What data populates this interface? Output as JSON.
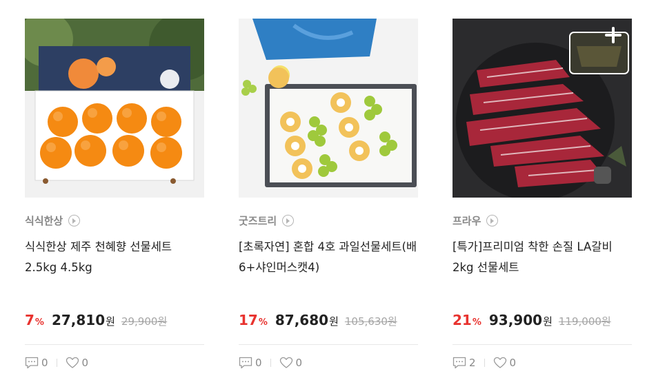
{
  "products": [
    {
      "image_icon": "tangerine-gift-box-photo",
      "seller": "식식한상",
      "title": "식식한상 제주 천혜향 선물세트 2.5kg 4.5kg",
      "discount": "7",
      "discount_unit": "%",
      "price": "27,810",
      "currency": "원",
      "original_price": "29,900원",
      "reviews": "0",
      "likes": "0"
    },
    {
      "image_icon": "fruit-gift-set-photo",
      "seller": "굿즈트리",
      "title": "[초록자연] 혼합 4호 과일선물세트(배6+샤인머스캣4)",
      "discount": "17",
      "discount_unit": "%",
      "price": "87,680",
      "currency": "원",
      "original_price": "105,630원",
      "reviews": "0",
      "likes": "0"
    },
    {
      "image_icon": "beef-ribs-gift-photo",
      "seller": "프라우",
      "title": "[특가]프리미엄 착한 손질 LA갈비 2kg 선물세트",
      "discount": "21",
      "discount_unit": "%",
      "price": "93,900",
      "currency": "원",
      "original_price": "119,000원",
      "reviews": "2",
      "likes": "0"
    }
  ],
  "colors": {
    "discount": "#e8332f",
    "muted": "#888888",
    "strike": "#a5a5a5"
  }
}
